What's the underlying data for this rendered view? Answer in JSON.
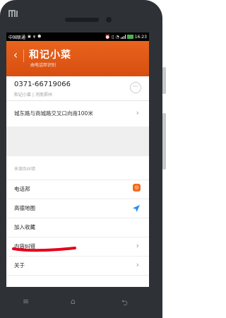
{
  "device": {
    "brand": "MI"
  },
  "statusbar": {
    "carrier": "中国联通",
    "time": "16:23"
  },
  "header": {
    "back": "‹",
    "title": "和记小菜",
    "subtitle": "由电话邦识别"
  },
  "contact": {
    "phone": "0371-66719066",
    "meta": "和记小菜 | 河南郑州",
    "more": "···"
  },
  "address": {
    "text": "城东路与商城路交叉口向南100米"
  },
  "section": {
    "label": "来源及纠错"
  },
  "items": [
    {
      "label": "电话邦",
      "icon": "dianhua-bang-icon"
    },
    {
      "label": "高德地图",
      "icon": "gaode-map-icon"
    },
    {
      "label": "加入收藏"
    },
    {
      "label": "内容纠错"
    },
    {
      "label": "关于"
    }
  ],
  "chevron": "›",
  "nav": {
    "menu": "≡",
    "home": "⌂",
    "back": "⮌"
  },
  "colors": {
    "header": "#e8641e",
    "annotation": "#e5001a"
  }
}
